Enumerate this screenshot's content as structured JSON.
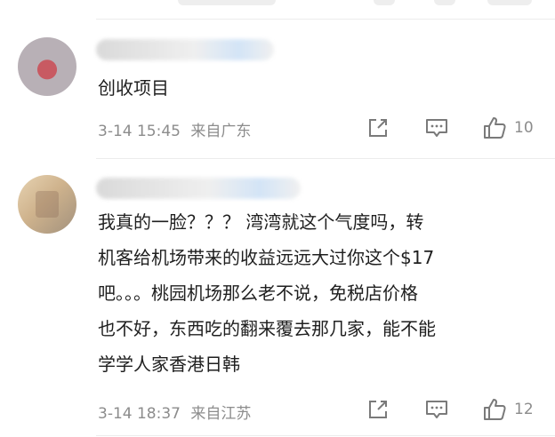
{
  "comments": [
    {
      "text": "创收项目",
      "date": "3-14 15:45",
      "location": "来自广东",
      "likes": "10"
    },
    {
      "text": "我真的一脸？？？ 湾湾就这个气度吗，转\n机客给机场带来的收益远远大过你这个$17\n吧。。。桃园机场那么老不说，免税店价格\n也不好，东西吃的翻来覆去那几家，能不能\n学学人家香港日韩",
      "date": "3-14 18:37",
      "location": "来自江苏",
      "likes": "12"
    }
  ],
  "icons": {
    "share": "share-icon",
    "reply": "comment-icon",
    "like": "thumbs-up-icon"
  }
}
